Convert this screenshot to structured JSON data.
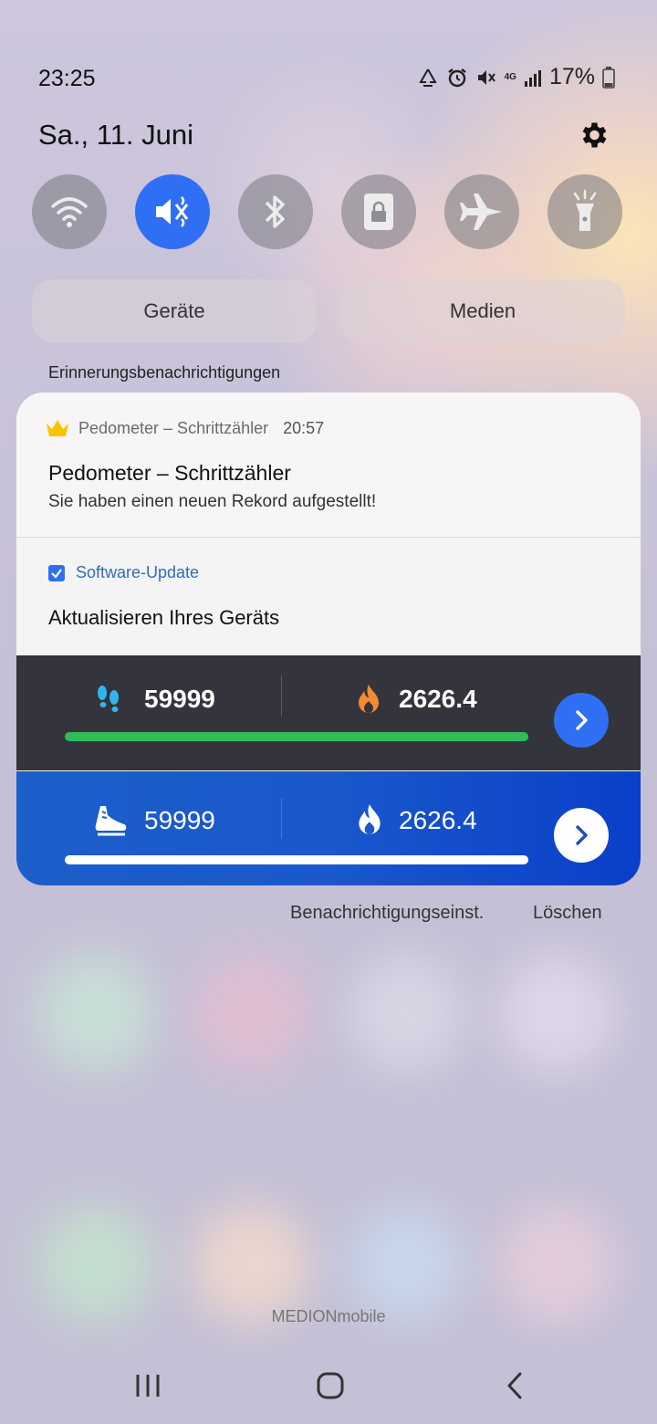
{
  "status_bar": {
    "time": "23:25",
    "network": "4G",
    "battery": "17%"
  },
  "header": {
    "date": "Sa., 11. Juni"
  },
  "quick_toggles": [
    {
      "name": "wifi-icon",
      "active": false
    },
    {
      "name": "mute-icon",
      "active": true
    },
    {
      "name": "bluetooth-icon",
      "active": false
    },
    {
      "name": "lock-rotation-icon",
      "active": false
    },
    {
      "name": "airplane-icon",
      "active": false
    },
    {
      "name": "flashlight-icon",
      "active": false
    }
  ],
  "pills": {
    "devices": "Geräte",
    "media": "Medien"
  },
  "section_label": "Erinnerungsbenachrichtigungen",
  "notification_pedometer": {
    "app_name": "Pedometer – Schrittzähler",
    "time": "20:57",
    "title": "Pedometer – Schrittzähler",
    "text": "Sie haben einen neuen Rekord aufgestellt!"
  },
  "notification_update": {
    "app_name": "Software-Update",
    "title": "Aktualisieren Ihres Geräts"
  },
  "widget_dark": {
    "steps": "59999",
    "calories": "2626.4",
    "progress": 1.0,
    "bar_color": "#2ebd59"
  },
  "widget_blue": {
    "steps": "59999",
    "calories": "2626.4",
    "progress": 1.0,
    "bar_color": "#ffffff"
  },
  "actions": {
    "settings": "Benachrichtigungseinst.",
    "clear": "Löschen"
  },
  "brand": "MEDIONmobile",
  "colors": {
    "accent": "#2f6ff3",
    "dark_panel": "#34343c",
    "blue_panel": "#1a58cc"
  }
}
